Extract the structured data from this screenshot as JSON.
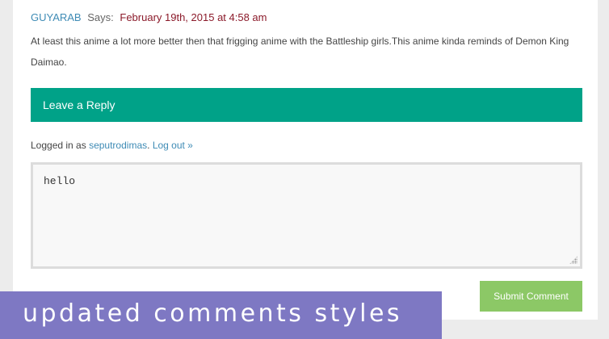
{
  "comment": {
    "author": "GUYARAB",
    "says": "Says:",
    "date": "February 19th, 2015 at 4:58 am",
    "text": "At least this anime a lot more better then that frigging anime with the Battleship girls.This anime kinda reminds of Demon King Daimao."
  },
  "reply": {
    "title": "Leave a Reply",
    "logged_in_prefix": "Logged in as",
    "username": "seputrodimas",
    "period": ".",
    "logout": "Log out »",
    "textarea_value": "hello",
    "submit_label": "Submit Comment"
  },
  "banner": {
    "text": "updated comments styles"
  },
  "colors": {
    "accent": "#00a288",
    "link": "#3e8bb5",
    "date": "#8b1a2a",
    "submit": "#8cc866",
    "banner": "#7e78c3"
  }
}
